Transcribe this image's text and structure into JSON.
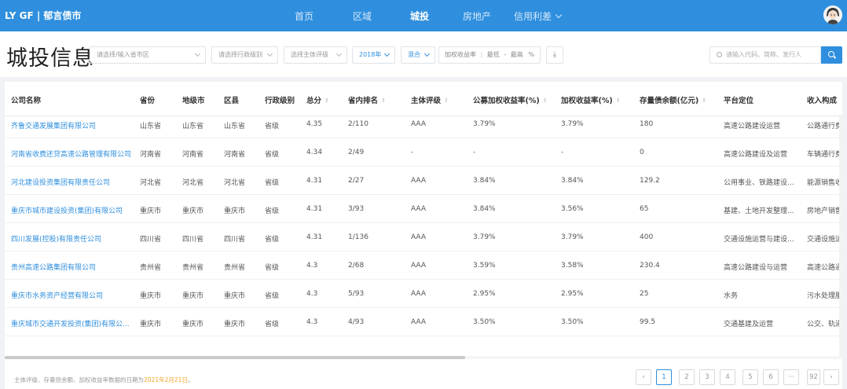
{
  "nav": {
    "brand": "LY GF | 郁言债市",
    "items": [
      {
        "label": "首页"
      },
      {
        "label": "区域"
      },
      {
        "label": "城投"
      },
      {
        "label": "房地产"
      },
      {
        "label": "信用利差"
      }
    ],
    "active": "城投"
  },
  "page": {
    "title": "城投信息"
  },
  "filters": {
    "province_placeholder": "请选择/输入省市区",
    "admin_level_placeholder": "请选择行政级别",
    "rating_placeholder": "选择主体评级",
    "year": "2018年",
    "mode": "混合",
    "yield_label": "加权收益率",
    "yield_min": "最低",
    "yield_sep": "-",
    "yield_max": "最高",
    "yield_unit": "%"
  },
  "search": {
    "placeholder": "请输入代码、简称、发行人"
  },
  "table": {
    "columns": [
      "公司名称",
      "省份",
      "地级市",
      "区县",
      "行政级别",
      "总分",
      "省内排名",
      "主体评级",
      "公募加权收益率(%)",
      "加权收益率(%)",
      "存量债余额(亿元)",
      "平台定位",
      "收入构成"
    ],
    "rows": [
      {
        "company": "齐鲁交通发展集团有限公司",
        "province": "山东省",
        "city": "山东省",
        "county": "山东省",
        "level": "省级",
        "score": "4.35",
        "rank": "2/110",
        "rating": "AAA",
        "public_yield": "3.79%",
        "yield": "3.79%",
        "balance": "180",
        "position": "高速公路建设运营",
        "revenue": "公路通行费"
      },
      {
        "company": "河南省收费还贷高速公路管理有限公司",
        "province": "河南省",
        "city": "河南省",
        "county": "河南省",
        "level": "省级",
        "score": "4.34",
        "rank": "2/49",
        "rating": "-",
        "public_yield": "-",
        "yield": "-",
        "balance": "0",
        "position": "高速公路建设及运营",
        "revenue": "车辆通行费"
      },
      {
        "company": "河北建设投资集团有限责任公司",
        "province": "河北省",
        "city": "河北省",
        "county": "河北省",
        "level": "省级",
        "score": "4.31",
        "rank": "2/27",
        "rating": "AAA",
        "public_yield": "3.84%",
        "yield": "3.84%",
        "balance": "129.2",
        "position": "公用事业、铁路建设...",
        "revenue": "能源销售收"
      },
      {
        "company": "重庆市城市建设投资(集团)有限公司",
        "province": "重庆市",
        "city": "重庆市",
        "county": "重庆市",
        "level": "省级",
        "score": "4.31",
        "rank": "3/93",
        "rating": "AAA",
        "public_yield": "3.84%",
        "yield": "3.56%",
        "balance": "65",
        "position": "基建、土地开发整理...",
        "revenue": "房地产销售"
      },
      {
        "company": "四川发展(控股)有限责任公司",
        "province": "四川省",
        "city": "四川省",
        "county": "四川省",
        "level": "省级",
        "score": "4.31",
        "rank": "1/136",
        "rating": "AAA",
        "public_yield": "3.79%",
        "yield": "3.79%",
        "balance": "400",
        "position": "交通设施运营与建设...",
        "revenue": "交通设施运"
      },
      {
        "company": "贵州高速公路集团有限公司",
        "province": "贵州省",
        "city": "贵州省",
        "county": "贵州省",
        "level": "省级",
        "score": "4.3",
        "rank": "2/68",
        "rating": "AAA",
        "public_yield": "3.59%",
        "yield": "3.58%",
        "balance": "230.4",
        "position": "高速公路建设与运营",
        "revenue": "高速公路通"
      },
      {
        "company": "重庆市水务资产经营有限公司",
        "province": "重庆市",
        "city": "重庆市",
        "county": "重庆市",
        "level": "省级",
        "score": "4.3",
        "rank": "5/93",
        "rating": "AAA",
        "public_yield": "2.95%",
        "yield": "2.95%",
        "balance": "25",
        "position": "水务",
        "revenue": "污水处理服"
      },
      {
        "company": "重庆城市交通开发投资(集团)有限公...",
        "province": "重庆市",
        "city": "重庆市",
        "county": "重庆市",
        "level": "省级",
        "score": "4.3",
        "rank": "4/93",
        "rating": "AAA",
        "public_yield": "3.50%",
        "yield": "3.50%",
        "balance": "99.5",
        "position": "交通基建及运营",
        "revenue": "公交、轨道"
      }
    ]
  },
  "footer": {
    "note_prefix": "主体评级、存量债余额、加权收益率数据的日期为",
    "note_date": "2021年2月21日",
    "note_suffix": "。"
  },
  "pagination": {
    "pages": [
      "1",
      "2",
      "3",
      "4",
      "5",
      "6",
      "···",
      "92"
    ],
    "current": "1",
    "prev": "‹",
    "next": "›"
  }
}
